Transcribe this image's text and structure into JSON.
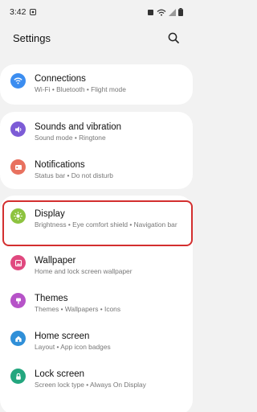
{
  "status": {
    "time": "3:42",
    "battery_icon": "battery-icon",
    "wifi_icon": "wifi-signal-icon"
  },
  "header": {
    "title": "Settings"
  },
  "items": [
    {
      "title": "Connections",
      "subtitle": "Wi-Fi  •  Bluetooth  •  Flight mode",
      "icon": "wifi-icon",
      "color": "#3b8df0"
    },
    {
      "title": "Sounds and vibration",
      "subtitle": "Sound mode  •  Ringtone",
      "icon": "speaker-icon",
      "color": "#7c5bd6"
    },
    {
      "title": "Notifications",
      "subtitle": "Status bar  •  Do not disturb",
      "icon": "notification-icon",
      "color": "#e8715f"
    },
    {
      "title": "Display",
      "subtitle": "Brightness  •  Eye comfort shield  •  Navigation bar",
      "icon": "sun-icon",
      "color": "#8dc33f"
    },
    {
      "title": "Wallpaper",
      "subtitle": "Home and lock screen wallpaper",
      "icon": "wallpaper-icon",
      "color": "#e0497f"
    },
    {
      "title": "Themes",
      "subtitle": "Themes  •  Wallpapers  •  Icons",
      "icon": "themes-icon",
      "color": "#b653c8"
    },
    {
      "title": "Home screen",
      "subtitle": "Layout  •  App icon badges",
      "icon": "home-icon",
      "color": "#2f8fd8"
    },
    {
      "title": "Lock screen",
      "subtitle": "Screen lock type  •  Always On Display",
      "icon": "lock-icon",
      "color": "#23a67e"
    }
  ]
}
